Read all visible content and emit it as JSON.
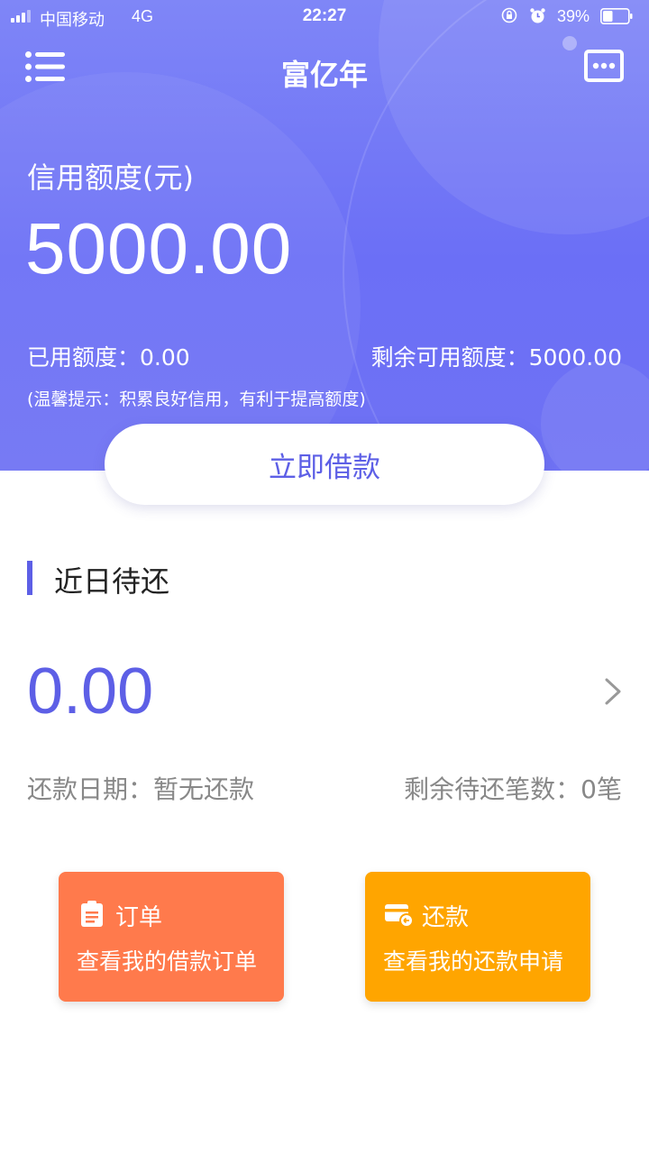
{
  "status_bar": {
    "carrier": "中国移动",
    "network": "4G",
    "time": "22:27",
    "battery_percent": "39%",
    "battery_level": 0.39
  },
  "header": {
    "title": "富亿年",
    "menu_icon": "list-menu-icon",
    "message_icon": "message-more-icon"
  },
  "credit": {
    "label": "信用额度(元)",
    "value": "5000.00",
    "used_text": "已用额度：0.00",
    "remaining_text": "剩余可用额度：5000.00",
    "tip": "(温馨提示：积累良好信用，有利于提高额度)"
  },
  "borrow_button": "立即借款",
  "recent_due": {
    "title": "近日待还",
    "amount": "0.00",
    "date_text": "还款日期：暂无还款",
    "count_text": "剩余待还笔数：0笔"
  },
  "cards": {
    "orders": {
      "title": "订单",
      "desc": "查看我的借款订单",
      "icon": "clipboard-icon"
    },
    "repay": {
      "title": "还款",
      "desc": "查看我的还款申请",
      "icon": "card-refund-icon"
    }
  },
  "colors": {
    "accent": "#5d5fe6",
    "hero": "#6f72f4",
    "orders_card": "#ff7a4c",
    "repay_card": "#ffa500"
  }
}
